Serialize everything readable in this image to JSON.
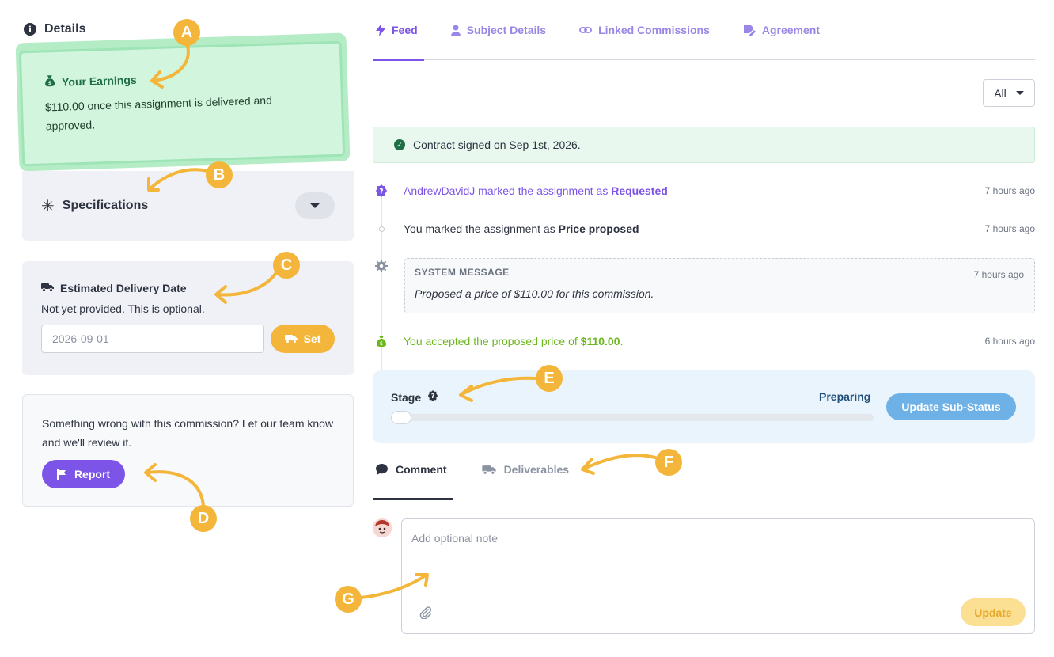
{
  "details": {
    "title": "Details"
  },
  "earnings": {
    "title": "Your Earnings",
    "body": "$110.00 once this assignment is delivered and approved."
  },
  "specifications": {
    "title": "Specifications"
  },
  "delivery": {
    "title": "Estimated Delivery Date",
    "subtitle": "Not yet provided. This is optional.",
    "date_value": "2026-09-01",
    "set_label": "Set"
  },
  "report": {
    "text": "Something wrong with this commission? Let our team know and we'll review it.",
    "button_label": "Report"
  },
  "tabs": [
    {
      "label": "Feed",
      "icon": "bolt-icon"
    },
    {
      "label": "Subject Details",
      "icon": "user-icon"
    },
    {
      "label": "Linked Commissions",
      "icon": "link-icon"
    },
    {
      "label": "Agreement",
      "icon": "signature-icon"
    }
  ],
  "filter": {
    "value": "All"
  },
  "contract": {
    "text": "Contract signed on Sep 1st, 2026."
  },
  "feed": [
    {
      "prefix": "AndrewDavidJ marked the assignment as ",
      "strong": "Requested",
      "suffix": "",
      "time": "7 hours ago"
    },
    {
      "prefix": "You marked the assignment as ",
      "strong": "Price proposed",
      "suffix": "",
      "time": "7 hours ago"
    },
    {
      "label": "SYSTEM MESSAGE",
      "body": "Proposed a price of $110.00 for this commission.",
      "time": "7 hours ago"
    },
    {
      "prefix": "You accepted the proposed price of ",
      "strong": "$110.00",
      "suffix": ".",
      "time": "6 hours ago"
    }
  ],
  "stage": {
    "label": "Stage",
    "status": "Preparing",
    "progress": 0,
    "button_label": "Update Sub-Status"
  },
  "comment_tabs": [
    {
      "label": "Comment"
    },
    {
      "label": "Deliverables"
    }
  ],
  "note": {
    "placeholder": "Add optional note",
    "button_label": "Update"
  },
  "callouts": [
    "A",
    "B",
    "C",
    "D",
    "E",
    "F",
    "G"
  ],
  "colors": {
    "accent": "#7c54e8",
    "callout": "#f4b63a",
    "success": "#1f6e45",
    "info": "#6eb1e6"
  }
}
